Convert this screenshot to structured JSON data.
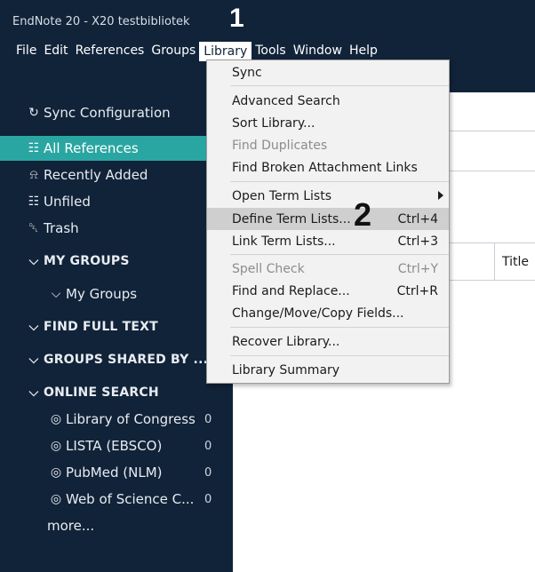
{
  "window": {
    "title": "EndNote 20 - X20 testbibliotek"
  },
  "menubar": [
    "File",
    "Edit",
    "References",
    "Groups",
    "Library",
    "Tools",
    "Window",
    "Help"
  ],
  "steps": {
    "one": "1",
    "two": "2"
  },
  "sidebar": {
    "sync": "Sync Configuration",
    "all_references": "All References",
    "recently_added": "Recently Added",
    "unfiled": "Unfiled",
    "trash": "Trash",
    "my_groups_header": "MY GROUPS",
    "my_groups_sub": "My Groups",
    "find_full_text": "FIND FULL TEXT",
    "groups_shared": "GROUPS SHARED BY ...",
    "online_search": "ONLINE SEARCH",
    "online": [
      {
        "label": "Library of Congress",
        "count": "0"
      },
      {
        "label": "LISTA (EBSCO)",
        "count": "0"
      },
      {
        "label": "PubMed (NLM)",
        "count": "0"
      },
      {
        "label": "Web of Science C...",
        "count": "0"
      }
    ],
    "more": "more..."
  },
  "content": {
    "title_column": "Title"
  },
  "library_menu": [
    {
      "label": "Sync",
      "shortcut": ""
    },
    {
      "label": "Advanced Search",
      "shortcut": ""
    },
    {
      "label": "Sort Library...",
      "shortcut": ""
    },
    {
      "label": "Find Duplicates",
      "shortcut": "",
      "disabled": true
    },
    {
      "label": "Find Broken Attachment Links",
      "shortcut": ""
    },
    {
      "label": "Open Term Lists",
      "shortcut": "",
      "submenu": true
    },
    {
      "label": "Define Term Lists...",
      "shortcut": "Ctrl+4",
      "highlighted": true
    },
    {
      "label": "Link Term Lists...",
      "shortcut": "Ctrl+3"
    },
    {
      "label": "Spell Check",
      "shortcut": "Ctrl+Y",
      "disabled": true
    },
    {
      "label": "Find and Replace...",
      "shortcut": "Ctrl+R"
    },
    {
      "label": "Change/Move/Copy Fields...",
      "shortcut": ""
    },
    {
      "label": "Recover Library...",
      "shortcut": ""
    },
    {
      "label": "Library Summary",
      "shortcut": ""
    }
  ],
  "colors": {
    "navy": "#112339",
    "selected": "#2aa6a2",
    "highlight": "#cfcfcf"
  },
  "icons": {
    "sync": "sync-icon",
    "all": "clipboard-icon",
    "recent": "bell-icon",
    "unfiled": "clipboard-icon",
    "trash": "trash-icon",
    "globe": "globe-icon"
  }
}
